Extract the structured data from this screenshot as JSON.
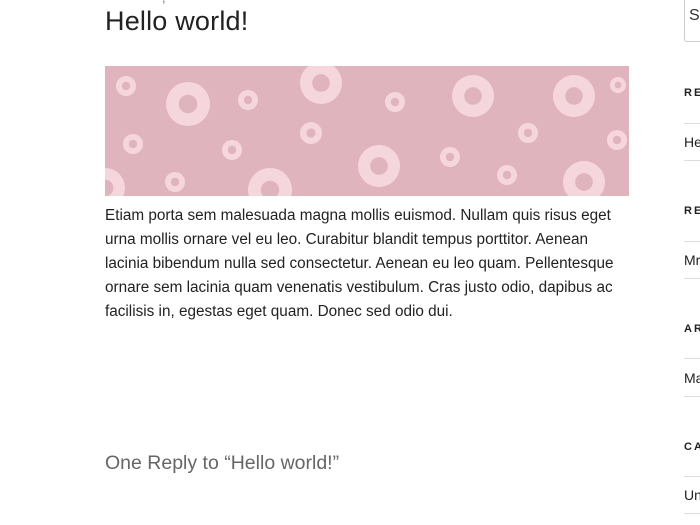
{
  "post": {
    "meta_fragment": ",",
    "title": "Hello world!",
    "content": "Etiam porta sem malesuada magna mollis euismod. Nullam quis risus eget urna mollis ornare vel eu leo. Curabitur blandit tempus porttitor. Aenean lacinia bibendum nulla sed consectetur. Aenean eu leo quam. Pellentesque ornare sem lacinia quam venenatis vestibulum. Cras justo odio, dapibus ac facilisis in, egestas eget quam. Donec sed odio dui.",
    "comments_title": "One Reply to “Hello world!”"
  },
  "featured_image": {
    "background_color": "#e0b4bd",
    "ring_color": "#f6d6dd"
  },
  "sidebar": {
    "search_fragment": "S",
    "widgets": [
      {
        "title": "RE",
        "item": "He"
      },
      {
        "title": "RE",
        "item": "Mr"
      },
      {
        "title": "AR",
        "item": "Ma"
      },
      {
        "title": "CA",
        "item": "Un"
      }
    ]
  }
}
